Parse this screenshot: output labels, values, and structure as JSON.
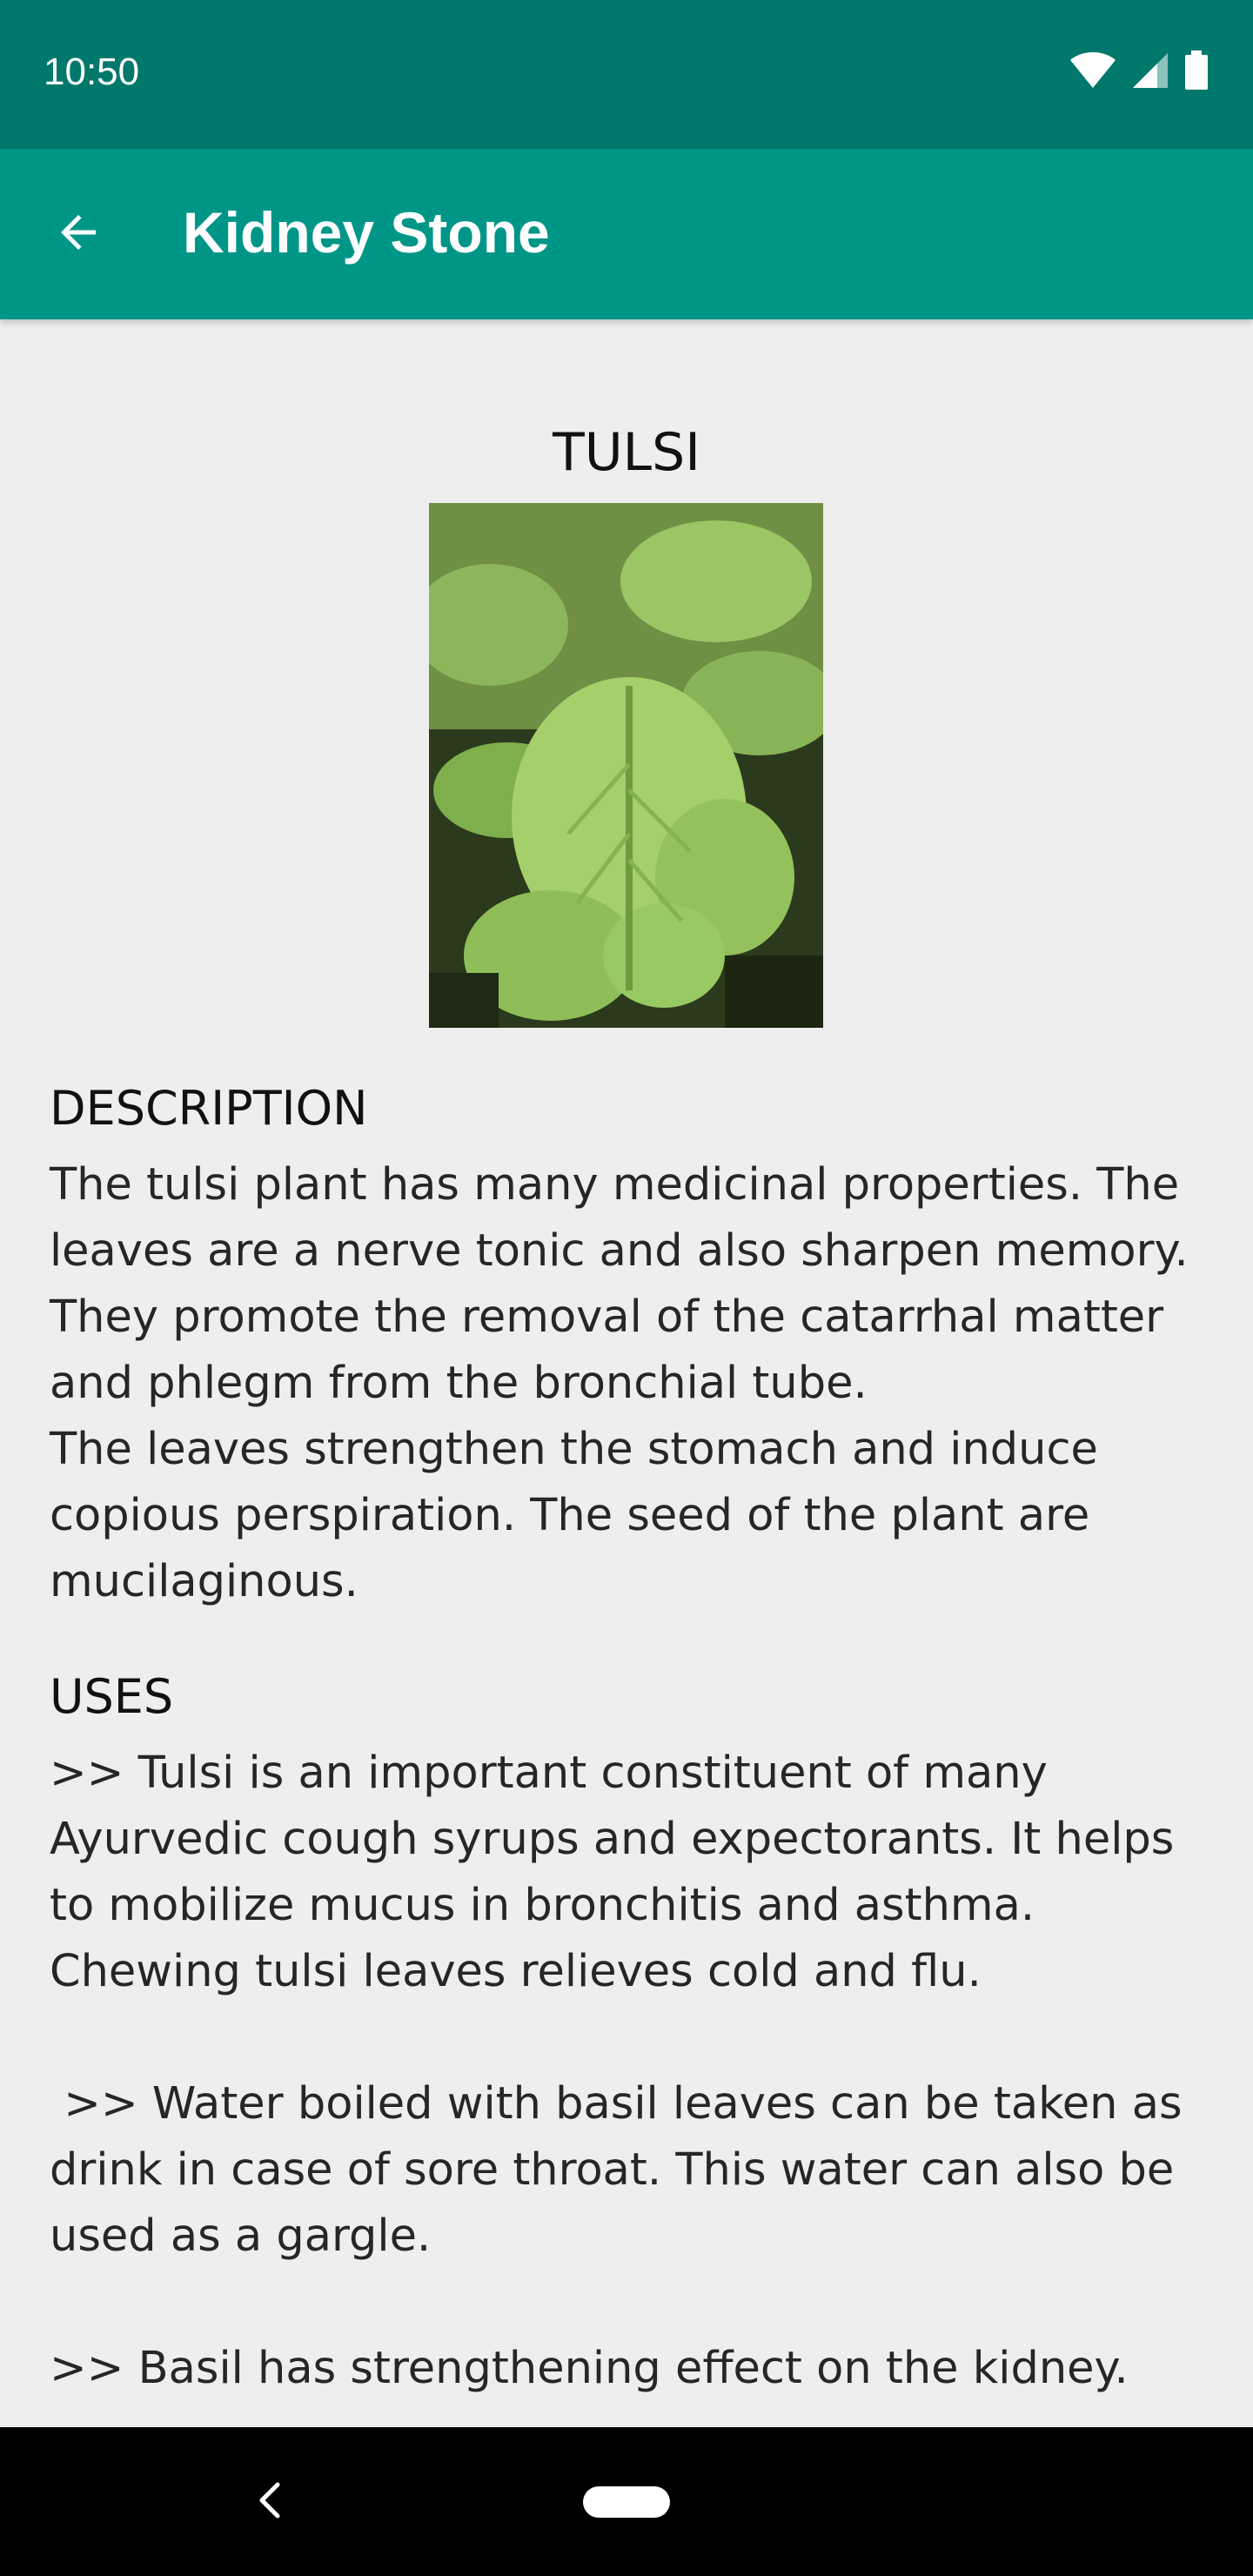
{
  "status_bar": {
    "time": "10:50",
    "icons": [
      "wifi-icon",
      "cellular-signal-icon",
      "battery-icon"
    ]
  },
  "app_bar": {
    "title": "Kidney Stone",
    "back_icon": "arrow-back-icon"
  },
  "plant": {
    "name": "TULSI",
    "image": "tulsi-plant-photo"
  },
  "description": {
    "heading": "DESCRIPTION",
    "text": "The tulsi plant has many medicinal properties. The leaves are a nerve tonic and also sharpen memory. They promote the removal of the catarrhal matter and phlegm from the bronchial tube.\nThe leaves strengthen the stomach and induce copious perspiration. The seed of the plant are mucilaginous."
  },
  "uses": {
    "heading": "USES",
    "text": ">> Tulsi is an important constituent of many Ayurvedic cough syrups and expectorants. It helps to mobilize mucus in bronchitis and asthma. Chewing tulsi leaves relieves cold and flu.\n\n >> Water boiled with basil leaves can be taken as drink in case of sore throat. This water can also be used as a gargle.\n\n>> Basil has strengthening effect on the kidney."
  },
  "nav_bar": {
    "back_icon": "nav-back-icon",
    "home_icon": "home-pill-icon"
  },
  "colors": {
    "status_bar": "#00786b",
    "app_bar": "#009687",
    "background": "#eeeeee",
    "nav_bar": "#000000"
  }
}
